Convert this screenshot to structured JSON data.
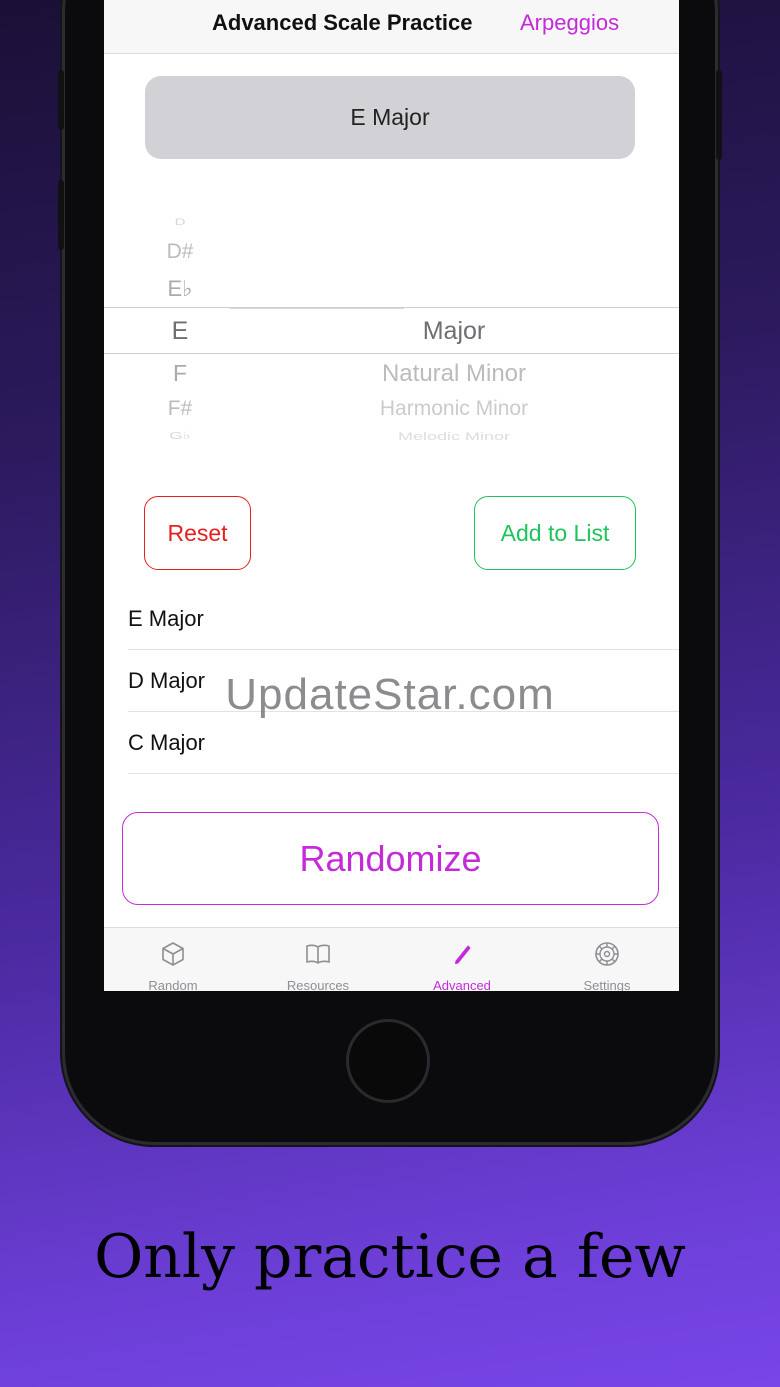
{
  "header": {
    "title": "Advanced Scale Practice",
    "right_link": "Arpeggios"
  },
  "selection": {
    "label": "E Major"
  },
  "picker": {
    "notes": [
      "D",
      "D#",
      "E♭",
      "E",
      "F",
      "F#",
      "G♭"
    ],
    "selected_note": "E",
    "types": [
      "Major",
      "Natural Minor",
      "Harmonic Minor",
      "Melodic Minor"
    ],
    "selected_type": "Major"
  },
  "buttons": {
    "reset": "Reset",
    "add_to_list": "Add to List",
    "randomize": "Randomize"
  },
  "list": [
    {
      "label": "E Major"
    },
    {
      "label": "D Major"
    },
    {
      "label": "C Major"
    }
  ],
  "tabs": [
    {
      "label": "Random",
      "icon": "cube-icon",
      "active": false
    },
    {
      "label": "Resources",
      "icon": "book-icon",
      "active": false
    },
    {
      "label": "Advanced",
      "icon": "pencil-icon",
      "active": true
    },
    {
      "label": "Settings",
      "icon": "gear-icon",
      "active": false
    }
  ],
  "watermark": "UpdateStar.com",
  "caption": "Only practice a few",
  "colors": {
    "accent": "#c42ad8",
    "reset": "#e5201e",
    "add": "#1fc35b",
    "selection_bg": "#d2d1d6"
  }
}
